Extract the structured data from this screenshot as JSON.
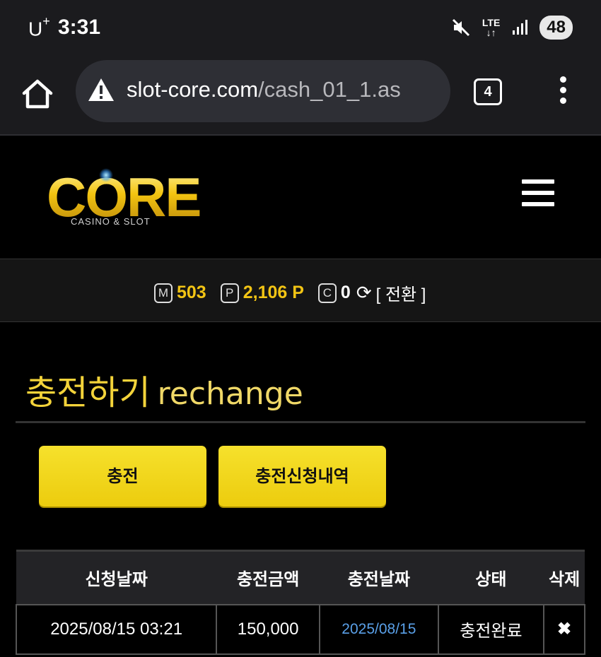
{
  "status_bar": {
    "carrier": "U",
    "carrier_sup": "+",
    "time": "3:31",
    "network": "LTE",
    "battery": "48"
  },
  "browser": {
    "url_main": "slot-core.com",
    "url_path": "/cash_01_1.as",
    "tab_count": "4"
  },
  "site": {
    "logo_text": "CORE",
    "logo_subtitle": "CASINO & SLOT"
  },
  "points": {
    "m_icon": "M",
    "m_value": "503",
    "p_icon": "P",
    "p_value": "2,106 P",
    "c_icon": "C",
    "c_value": "0",
    "switch_label": "[ 전환 ]"
  },
  "page": {
    "title_ko": "충전하기",
    "title_en": "rechange"
  },
  "buttons": {
    "charge": "충전",
    "history": "충전신청내역"
  },
  "table": {
    "headers": [
      "신청날짜",
      "충전금액",
      "충전날짜",
      "상태",
      "삭제"
    ],
    "rows": [
      {
        "request_date": "2025/08/15 03:21",
        "amount": "150,000",
        "charge_date": "2025/08/15",
        "status": "충전완료",
        "delete": "✖"
      }
    ]
  },
  "colors": {
    "accent_yellow": "#f3d33a",
    "link_blue": "#5aa0e8"
  }
}
